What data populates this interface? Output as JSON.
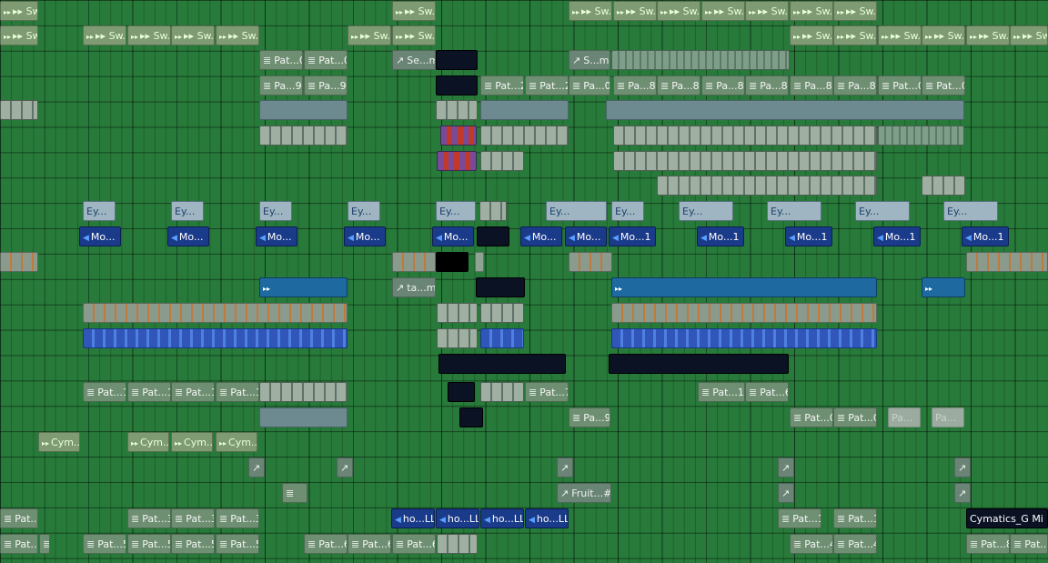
{
  "playlist": {
    "clips": {
      "sw_al": "▸▸ Sw...al",
      "sw_2": "▸▸ Sw...#2",
      "pat_0": "Pat...0",
      "pa_9": "Pa...9",
      "pat_2": "Pat...2",
      "pa_0": "Pa...0",
      "pa_8": "Pa...8",
      "se_me": "Se...me",
      "s_me": "S...me",
      "ey": "Ey...",
      "mo": "Mo...",
      "mo_1": "Mo...1",
      "ta_me": "ta...me",
      "pat_1": "Pat...1",
      "pat_7": "Pat...7",
      "pat_16": "Pat...16",
      "pat_6": "Pat...6",
      "pa": "Pa...",
      "cym": "Cym...",
      "fruit_2": "Fruit...#2",
      "pat_3": "Pat...3",
      "pat_4": "Pat...4",
      "pat_5": "Pat...5",
      "pat_8": "Pat...8",
      "ho_ll": "ho...LL",
      "cymatics": "Cymatics_G Mi"
    }
  }
}
